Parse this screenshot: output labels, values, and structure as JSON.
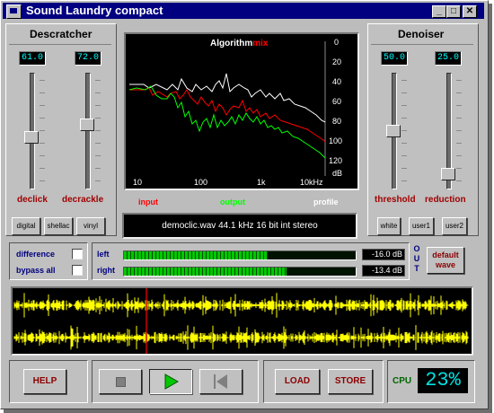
{
  "window": {
    "title": "Sound Laundry compact",
    "min_label": "_",
    "max_label": "□",
    "close_label": "✕"
  },
  "descratcher": {
    "title": "Descratcher",
    "declick": {
      "value": "61.0",
      "label": "declick",
      "level": 0.56
    },
    "decrackle": {
      "value": "72.0",
      "label": "decrackle",
      "level": 0.44
    },
    "presets": [
      "digital",
      "shellac",
      "vinyl"
    ]
  },
  "denoiser": {
    "title": "Denoiser",
    "threshold": {
      "value": "50.0",
      "label": "threshold",
      "level": 0.5
    },
    "reduction": {
      "value": "25.0",
      "label": "reduction",
      "level": 0.91
    },
    "presets": [
      "white",
      "user1",
      "user2"
    ]
  },
  "graph": {
    "title_a": "Algorithm",
    "title_b": "mix",
    "x_ticks": [
      "10",
      "100",
      "1k",
      "10kHz"
    ],
    "y_ticks": [
      "0",
      "20",
      "40",
      "60",
      "80",
      "100",
      "120",
      "dB"
    ],
    "legend": {
      "input": "input",
      "output": "output",
      "profile": "profile"
    },
    "colors": {
      "input": "#ff0000",
      "output": "#00ff00",
      "profile": "#ffffff",
      "title_a": "#ffffff",
      "title_b": "#ff0000"
    }
  },
  "file_info": "democlic.wav  44.1 kHz  16 bit  int  stereo",
  "controls": {
    "difference": "difference",
    "bypass_all": "bypass all"
  },
  "levels": {
    "left": {
      "label": "left",
      "db": "-16.0 dB",
      "level": 0.62
    },
    "right": {
      "label": "right",
      "db": "-13.4 dB",
      "level": 0.7
    }
  },
  "out_label": "OUT",
  "default_wave": {
    "line1": "default",
    "line2": "wave"
  },
  "buttons": {
    "help": "HELP",
    "load": "LOAD",
    "store": "STORE"
  },
  "cpu": {
    "label": "CPU",
    "value": "23%"
  }
}
